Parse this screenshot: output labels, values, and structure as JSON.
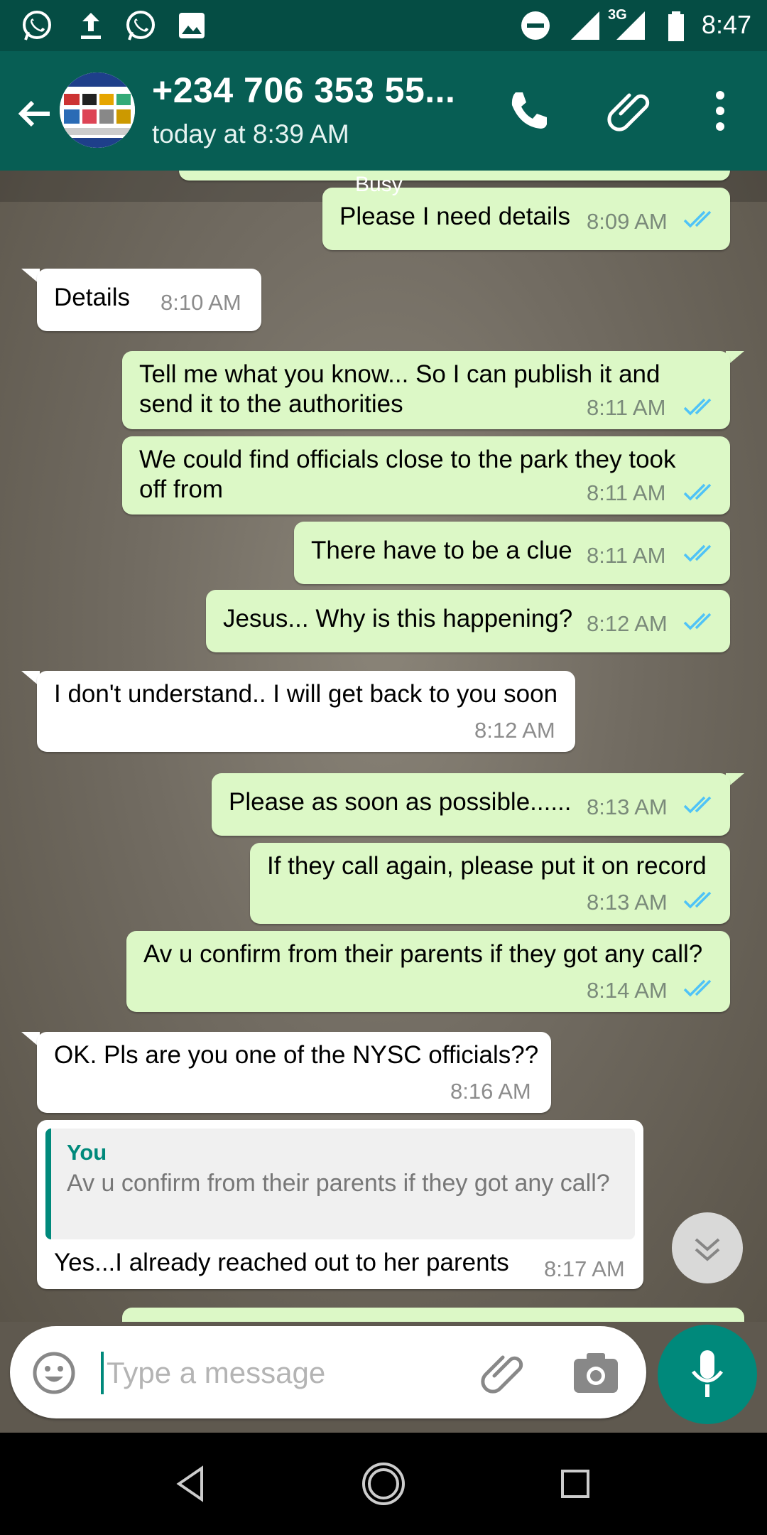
{
  "status_bar": {
    "time": "8:47",
    "network": "3G",
    "icons": [
      "whatsapp-icon",
      "upload-icon",
      "whatsapp-icon",
      "image-icon",
      "do-not-disturb-icon",
      "signal-icon",
      "battery-icon"
    ]
  },
  "header": {
    "contact": "+234 706 353 55...",
    "last_seen": "today at 8:39 AM"
  },
  "messages": [
    {
      "dir": "out",
      "text": "Please I need details",
      "time": "8:09 AM",
      "note": "Busy"
    },
    {
      "dir": "in",
      "text": "Details",
      "time": "8:10 AM"
    },
    {
      "dir": "out",
      "text": "Tell me what you know... So I can publish it and send it to the authorities",
      "line1": "Tell me what you know... So I can publish it and",
      "line2": "send it to the authorities",
      "time": "8:11 AM"
    },
    {
      "dir": "out",
      "text": "We could find officials close to the park they took off from",
      "line1": "We could find officials close to the park they took",
      "line2": "off from",
      "time": "8:11 AM"
    },
    {
      "dir": "out",
      "text": "There have to be a clue",
      "time": "8:11 AM"
    },
    {
      "dir": "out",
      "text": "Jesus... Why is this happening?",
      "time": "8:12 AM"
    },
    {
      "dir": "in",
      "text": "I don't understand.. I will get back to you soon",
      "time": "8:12 AM"
    },
    {
      "dir": "out",
      "text": "Please as soon as possible......",
      "time": "8:13 AM"
    },
    {
      "dir": "out",
      "text": "If they call again, please put it on record",
      "time": "8:13 AM"
    },
    {
      "dir": "out",
      "text": "Av u confirm from their parents if they got any call?",
      "time": "8:14 AM"
    },
    {
      "dir": "in",
      "text": "OK.  Pls are you one of the NYSC officials??",
      "time": "8:16 AM"
    },
    {
      "dir": "in",
      "text": "Yes...I already reached out to her parents",
      "time": "8:17 AM",
      "quote": {
        "author": "You",
        "text": "Av u confirm from their parents if they got any call?"
      }
    }
  ],
  "input": {
    "placeholder": "Type a message"
  },
  "colors": {
    "header": "#075e54",
    "status_bar": "#054d44",
    "outgoing_bubble": "#dcf8c6",
    "incoming_bubble": "#ffffff",
    "accent": "#00897b",
    "read_ticks": "#4fc3f7"
  }
}
